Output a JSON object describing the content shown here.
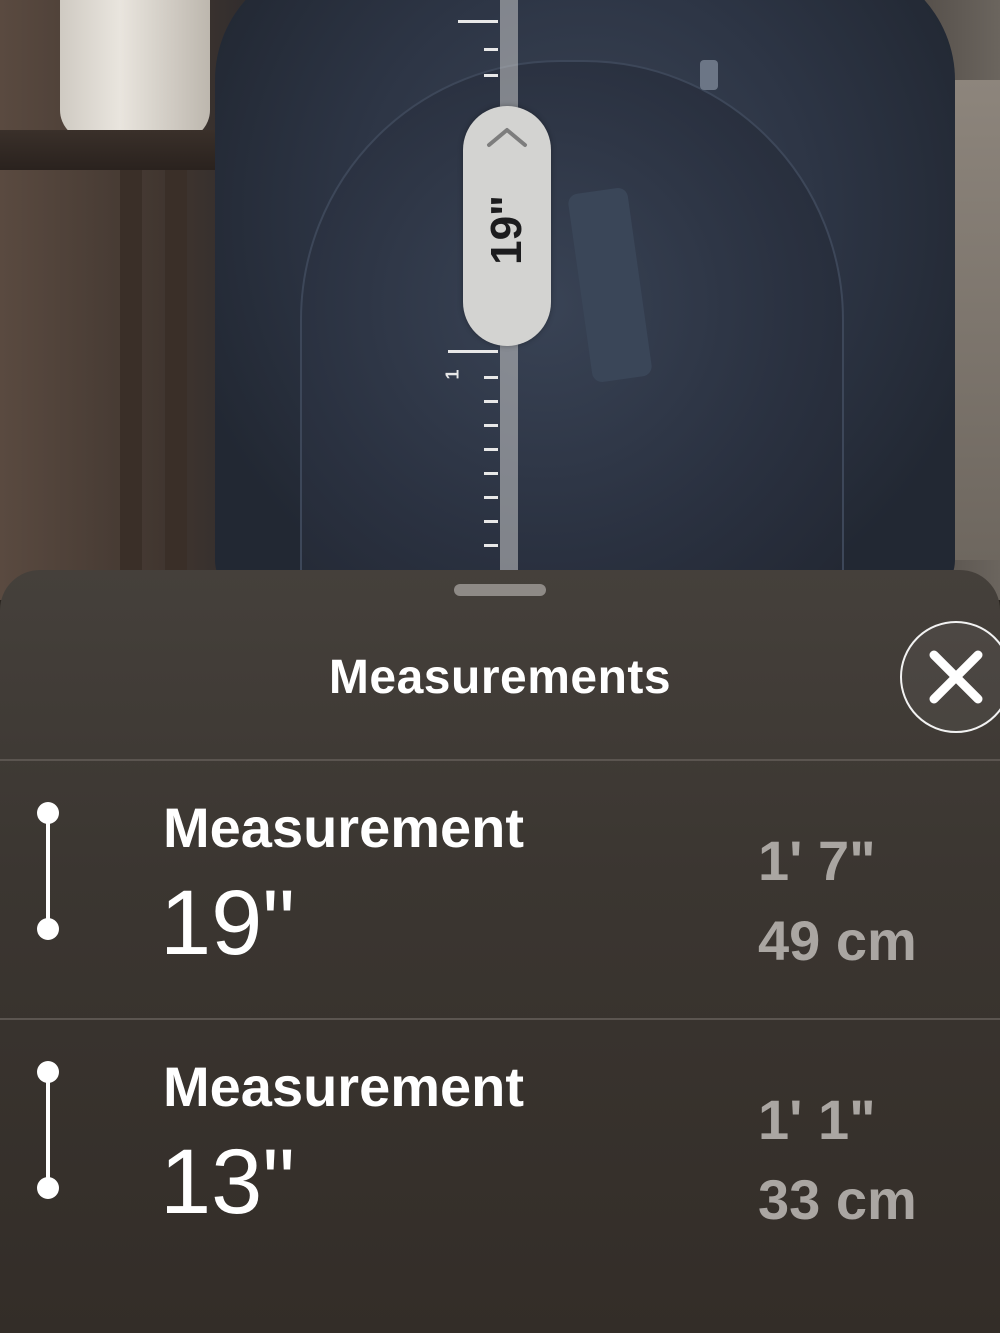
{
  "ar_view": {
    "pill_label": "19\"",
    "ruler_number": "1"
  },
  "sheet": {
    "title": "Measurements",
    "close_icon": "close-x-icon",
    "items": [
      {
        "label": "Measurement",
        "value": "19\"",
        "feet_inches": "1' 7\"",
        "metric": "49 cm",
        "icon": "measure-line-icon"
      },
      {
        "label": "Measurement",
        "value": "13\"",
        "feet_inches": "1' 1\"",
        "metric": "33 cm",
        "icon": "measure-line-icon"
      }
    ]
  },
  "colors": {
    "sheet_background": "#3b3631",
    "primary_text": "#ffffff",
    "secondary_text": "#aaa6a2",
    "pill_background": "#d3d3d1"
  }
}
